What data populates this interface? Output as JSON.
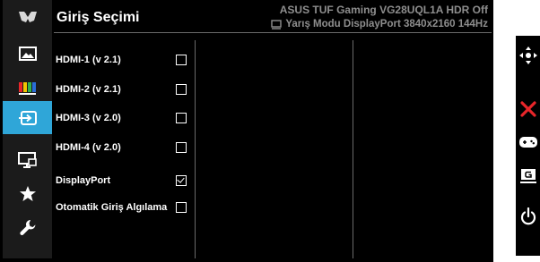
{
  "header": {
    "title": "Giriş Seçimi",
    "model": "ASUS TUF Gaming VG28UQL1A  HDR Off",
    "status": "Yarış Modu DisplayPort 3840x2160 144Hz"
  },
  "sidebar": {
    "items": [
      {
        "icon": "tuf-logo-icon",
        "active": false
      },
      {
        "icon": "image-icon",
        "active": false
      },
      {
        "icon": "color-bars-icon",
        "active": false
      },
      {
        "icon": "input-select-icon",
        "active": true
      },
      {
        "icon": "monitor-settings-icon",
        "active": false
      },
      {
        "icon": "star-icon",
        "active": false
      },
      {
        "icon": "wrench-icon",
        "active": false
      }
    ]
  },
  "inputs": [
    {
      "label": "HDMI-1 (v 2.1)",
      "checked": false
    },
    {
      "label": "HDMI-2 (v 2.1)",
      "checked": false
    },
    {
      "label": "HDMI-3 (v 2.0)",
      "checked": false
    },
    {
      "label": "HDMI-4 (v 2.0)",
      "checked": false
    },
    {
      "label": "DisplayPort",
      "checked": true
    },
    {
      "label": "Otomatik Giriş Algılama",
      "checked": false
    }
  ],
  "keys": [
    {
      "icon": "five-way-joystick-icon",
      "color": "#ffffff"
    },
    {
      "icon": "close-icon",
      "color": "#e8262a"
    },
    {
      "icon": "gamepad-icon",
      "color": "#ffffff"
    },
    {
      "icon": "gameplus-g-icon",
      "color": "#ffffff"
    },
    {
      "icon": "power-icon",
      "color": "#ffffff"
    }
  ],
  "colors": {
    "accent": "#2fa6d8",
    "header_text": "#8e8e8e",
    "close": "#e8262a"
  }
}
